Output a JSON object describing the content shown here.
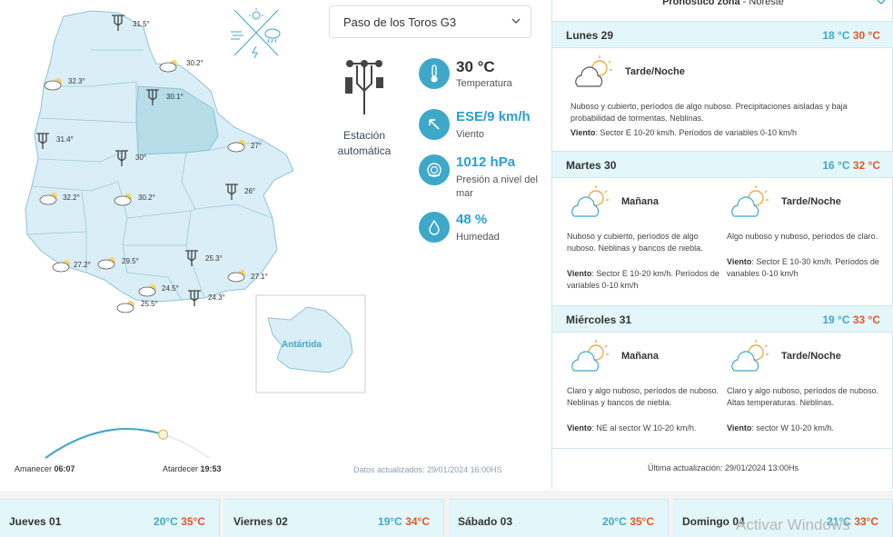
{
  "map": {
    "antarctica_label": "Antártida",
    "cities": [
      {
        "temp": "31.5°",
        "icon": "station-icon"
      },
      {
        "temp": "30.2°",
        "icon": "partly-cloudy-icon"
      },
      {
        "temp": "32.3°",
        "icon": "partly-cloudy-icon"
      },
      {
        "temp": "30.1°",
        "icon": "station-icon"
      },
      {
        "temp": "31.4°",
        "icon": "station-icon"
      },
      {
        "temp": "30°",
        "icon": "station-icon"
      },
      {
        "temp": "27°",
        "icon": "partly-cloudy-icon"
      },
      {
        "temp": "26°",
        "icon": "station-icon"
      },
      {
        "temp": "32.2°",
        "icon": "partly-cloudy-icon"
      },
      {
        "temp": "30.2°",
        "icon": "partly-cloudy-icon"
      },
      {
        "temp": "27.2°",
        "icon": "partly-cloudy-icon"
      },
      {
        "temp": "29.5°",
        "icon": "partly-cloudy-icon"
      },
      {
        "temp": "25.3°",
        "icon": "station-icon"
      },
      {
        "temp": "27.1°",
        "icon": "partly-cloudy-icon"
      },
      {
        "temp": "24.5°",
        "icon": "partly-cloudy-icon"
      },
      {
        "temp": "24.3°",
        "icon": "station-icon"
      },
      {
        "temp": "25.5°",
        "icon": "partly-cloudy-icon"
      }
    ]
  },
  "station": {
    "selected": "Paso de los Toros G3",
    "type_label_1": "Estación",
    "type_label_2": "automática"
  },
  "metrics": {
    "temperature": {
      "value": "30 °C",
      "label": "Temperatura"
    },
    "wind": {
      "value": "ESE/9 km/h",
      "label": "Viento"
    },
    "pressure": {
      "value": "1012 hPa",
      "label": "Presión a nivel del mar"
    },
    "humidity": {
      "value": "48 %",
      "label": "Humedad"
    }
  },
  "sun": {
    "sunrise_label": "Amanecer",
    "sunrise_time": "06:07",
    "sunset_label": "Atardecer",
    "sunset_time": "19:53",
    "progress_fraction": 0.72
  },
  "updated_left": "Datos actualizados: 29/01/2024 16:00HS",
  "forecast": {
    "zone_label": "Pronóstico zona",
    "zone_name": "Noreste",
    "days": [
      {
        "name": "Lunes 29",
        "min": "18 °C",
        "max": "30 °C",
        "periods": [
          {
            "name": "Tarde/Noche",
            "desc": "Nuboso y cubierto, períodos de algo nuboso. Precipitaciones aisladas y baja probabilidad de tormentas. Neblinas.",
            "wind_label": "Viento",
            "wind": ": Sector E 10-20 km/h. Períodos de variables 0-10 km/h"
          }
        ]
      },
      {
        "name": "Martes 30",
        "min": "16 °C",
        "max": "32 °C",
        "periods": [
          {
            "name": "Mañana",
            "desc": "Nuboso y cubierto, períodos de algo nuboso. Neblinas y bancos de niebla.",
            "wind_label": "Viento",
            "wind": ": Sector E 10-20 km/h. Períodos de variables 0-10 km/h"
          },
          {
            "name": "Tarde/Noche",
            "desc": "Algo nuboso y nuboso, períodos de claro.",
            "wind_label": "Viento",
            "wind": ": Sector E 10-30 km/h. Períodos de variables 0-10 km/h"
          }
        ]
      },
      {
        "name": "Miércoles 31",
        "min": "19 °C",
        "max": "33 °C",
        "periods": [
          {
            "name": "Mañana",
            "desc": "Claro y algo nuboso, períodos de nuboso. Neblinas y bancos de niebla.",
            "wind_label": "Viento",
            "wind": ": NE al sector W 10-20 km/h."
          },
          {
            "name": "Tarde/Noche",
            "desc": "Claro y algo nuboso, períodos de nuboso. Altas temperaturas. Neblinas.",
            "wind_label": "Viento",
            "wind": ": sector W 10-20 km/h."
          }
        ]
      }
    ],
    "updated": "Última actualización: 29/01/2024 13:00Hs"
  },
  "extended": [
    {
      "name": "Jueves 01",
      "min": "20°C",
      "max": "35°C"
    },
    {
      "name": "Viernes 02",
      "min": "19°C",
      "max": "34°C"
    },
    {
      "name": "Sábado 03",
      "min": "20°C",
      "max": "35°C"
    },
    {
      "name": "Domingo 04",
      "min": "21°C",
      "max": "33°C"
    }
  ],
  "watermark": "Activar Windows",
  "colors": {
    "accent": "#3ea8c9",
    "max_temp": "#e0582a",
    "map_fill": "#d9eef6",
    "map_highlight": "#b7dde8"
  }
}
